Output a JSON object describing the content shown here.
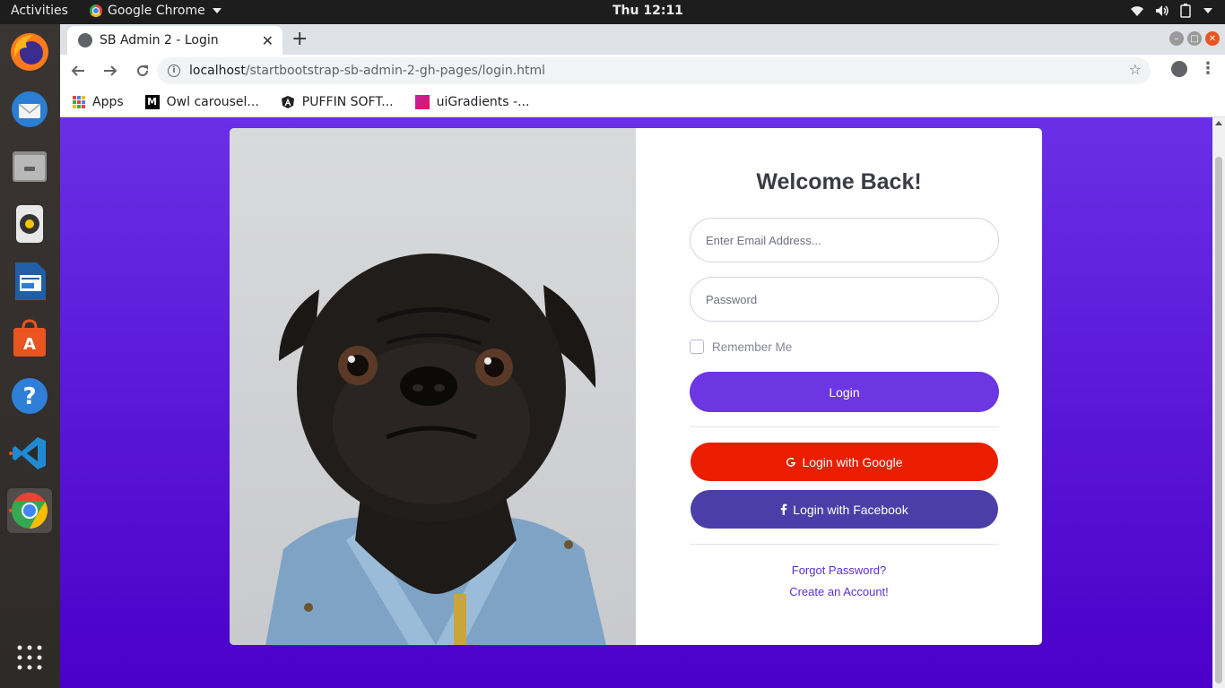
{
  "system": {
    "activities": "Activities",
    "app_name": "Google Chrome",
    "clock": "Thu 12:11",
    "tray_icons": [
      "wifi-icon",
      "volume-icon",
      "battery-icon",
      "system-menu-icon"
    ]
  },
  "dock": {
    "items": [
      "firefox",
      "thunderbird",
      "files",
      "rhythmbox",
      "libreoffice-writer",
      "ubuntu-software",
      "help",
      "vscode",
      "chrome",
      "show-applications"
    ],
    "active": "chrome"
  },
  "browser": {
    "tab_title": "SB Admin 2 - Login",
    "url_host": "localhost",
    "url_path": "/startbootstrap-sb-admin-2-gh-pages/login.html",
    "bookmarks": [
      {
        "label": "Apps",
        "icon": "apps-grid-icon"
      },
      {
        "label": "Owl carousel...",
        "icon": "medium-icon"
      },
      {
        "label": "PUFFIN SOFT...",
        "icon": "angular-icon"
      },
      {
        "label": "uiGradients -...",
        "icon": "uigradients-icon"
      }
    ]
  },
  "login": {
    "heading": "Welcome Back!",
    "email_placeholder": "Enter Email Address...",
    "password_placeholder": "Password",
    "remember_label": "Remember Me",
    "login_button": "Login",
    "google_button": "Login with Google",
    "facebook_button": "Login with Facebook",
    "forgot_link": "Forgot Password?",
    "create_link": "Create an Account!"
  },
  "colors": {
    "page_gradient_top": "#6a2fe6",
    "page_gradient_bottom": "#4b00c8",
    "login_button": "#6c36e2",
    "google_button": "#ea1d01",
    "facebook_button": "#4c3ea8",
    "link": "#5a2fd1"
  }
}
